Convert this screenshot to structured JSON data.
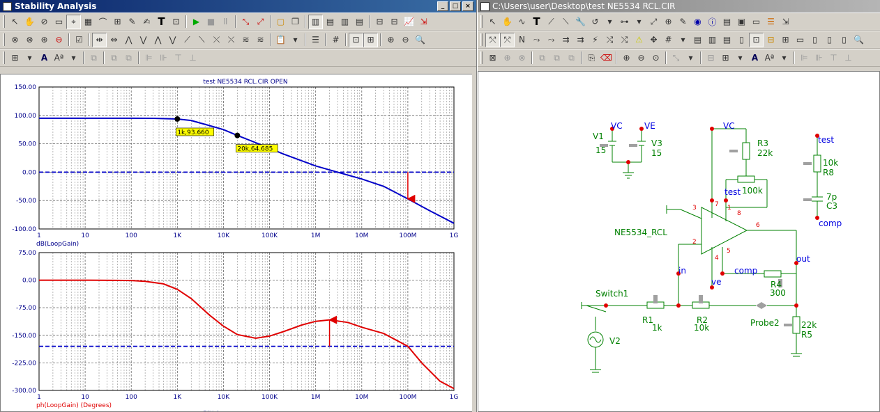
{
  "left_window": {
    "title": "Stability Analysis",
    "chart_title": "test NE5534 RCL.CIR OPEN"
  },
  "right_window": {
    "title": "C:\\Users\\user\\Desktop\\test NE5534 RCL.CIR"
  },
  "icons": [
    "cursor-icon",
    "hand-icon",
    "wave-icon",
    "text-icon",
    "zoom-in-icon",
    "zoom-out-icon",
    "play-icon",
    "stop-icon",
    "pause-icon",
    "probe-icon",
    "grid-icon",
    "font-icon",
    "align-icon"
  ],
  "chart_data": [
    {
      "type": "line",
      "title": "test NE5534 RCL.CIR OPEN",
      "xlabel": "",
      "ylabel": "dB(LoopGain)",
      "xscale": "log",
      "xlim": [
        1,
        1000000000
      ],
      "ylim": [
        -100,
        150
      ],
      "xticks": [
        "1",
        "10",
        "100",
        "1K",
        "10K",
        "100K",
        "1M",
        "10M",
        "100M",
        "1G"
      ],
      "yticks": [
        "150.00",
        "100.00",
        "50.00",
        "0.00",
        "-50.00",
        "-100.00"
      ],
      "series": [
        {
          "name": "dB(LoopGain)",
          "color": "#0000c8",
          "x": [
            1,
            10,
            100,
            300,
            1000,
            2000,
            5000,
            10000,
            20000,
            50000,
            100000,
            200000,
            500000,
            1000000,
            3000000,
            10000000,
            30000000,
            100000000,
            300000000,
            1000000000
          ],
          "y": [
            95,
            95,
            95,
            94.8,
            93.66,
            91,
            82,
            75,
            64.685,
            52,
            42,
            32,
            20,
            11,
            0,
            -12,
            -25,
            -47,
            -68,
            -90
          ]
        }
      ],
      "reference_line": {
        "y": 0,
        "color": "#0000c8",
        "style": "dashed"
      },
      "markers": [
        {
          "x": 1000,
          "y": 93.66,
          "label": "1k,93.660"
        },
        {
          "x": 20000,
          "y": 64.685,
          "label": "20k,64.685"
        }
      ],
      "arrow": {
        "x": 100000000,
        "from": 0,
        "to": -47,
        "color": "#e00000"
      }
    },
    {
      "type": "line",
      "xlabel": "F(Hz)",
      "ylabel": "ph(LoopGain) (Degrees)",
      "xscale": "log",
      "xlim": [
        1,
        1000000000
      ],
      "ylim": [
        -300,
        75
      ],
      "xticks": [
        "1",
        "10",
        "100",
        "1K",
        "10K",
        "100K",
        "1M",
        "10M",
        "100M",
        "1G"
      ],
      "yticks": [
        "75.00",
        "0.00",
        "-75.00",
        "-150.00",
        "-225.00",
        "-300.00"
      ],
      "series": [
        {
          "name": "ph(LoopGain)",
          "color": "#e00000",
          "x": [
            1,
            10,
            50,
            100,
            200,
            500,
            1000,
            2000,
            5000,
            10000,
            20000,
            50000,
            100000,
            200000,
            500000,
            1000000,
            2000000,
            5000000,
            10000000,
            30000000,
            100000000,
            200000000,
            500000000,
            1000000000
          ],
          "y": [
            0,
            0,
            -0.5,
            -1,
            -3,
            -10,
            -25,
            -50,
            -95,
            -125,
            -148,
            -158,
            -152,
            -140,
            -122,
            -112,
            -108,
            -115,
            -128,
            -145,
            -180,
            -225,
            -275,
            -295
          ]
        }
      ],
      "reference_line": {
        "y": -180,
        "color": "#0000c8",
        "style": "dashed"
      },
      "arrow": {
        "x": 2000000,
        "from": -180,
        "to": -108,
        "color": "#e00000"
      }
    }
  ],
  "schematic": {
    "labels": {
      "v1": "V1",
      "v1_val": "15",
      "v3": "V3",
      "v3_val": "15",
      "vc1": "VC",
      "ve1": "VE",
      "vc2": "VC",
      "r3": "R3",
      "r3_val": "22k",
      "pot_label": "test",
      "pot_val": "100k",
      "opamp": "NE5534_RCL",
      "pin3": "3",
      "pin2": "2",
      "pin7": "7",
      "pin1": "1",
      "pin8": "8",
      "pin6": "6",
      "pin4": "4",
      "pin5": "5",
      "in": "in",
      "ve2": "ve",
      "comp": "comp",
      "out": "out",
      "r4": "R4",
      "r4_val": "300",
      "switch": "Switch1",
      "r1": "R1",
      "r1_val": "1k",
      "r2": "R2",
      "r2_val": "10k",
      "probe": "Probe2",
      "r5": "R5",
      "r5_val": "22k",
      "v2": "V2",
      "test_net": "test",
      "r8_val": "10k",
      "r8": "R8",
      "c3_val": "7p",
      "c3": "C3",
      "comp_net": "comp"
    }
  }
}
